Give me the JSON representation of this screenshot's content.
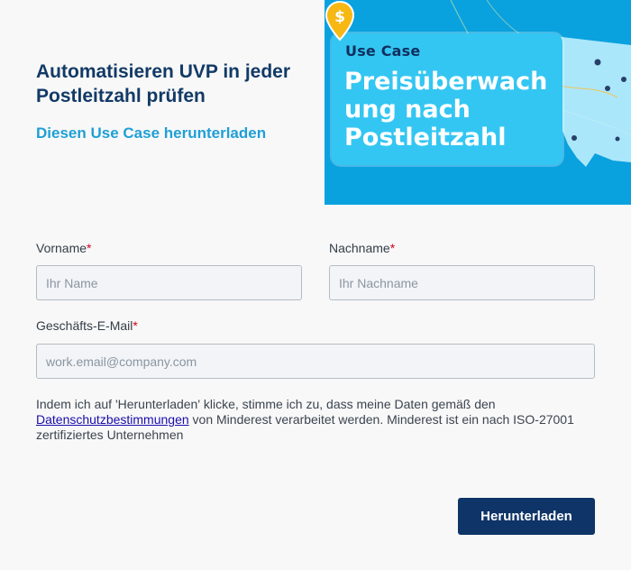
{
  "header": {
    "title": "Automatisieren UVP in jeder Postleitzahl prüfen",
    "download_link": "Diesen Use Case herunterladen"
  },
  "hero": {
    "tag": "Use Case",
    "title": "Preisüberwach\nung nach\nPostleitzahl",
    "icon": "dollar-map-pin",
    "background": "#0aa1df"
  },
  "form": {
    "first_name": {
      "label": "Vorname",
      "required_mark": "*",
      "placeholder": "Ihr Name",
      "value": ""
    },
    "last_name": {
      "label": "Nachname",
      "required_mark": "*",
      "placeholder": "Ihr Nachname",
      "value": ""
    },
    "email": {
      "label": "Geschäfts-E-Mail",
      "required_mark": "*",
      "placeholder": "work.email@company.com",
      "value": ""
    },
    "consent": {
      "before": "Indem ich auf 'Herunterladen' klicke, stimme ich zu, dass meine Daten gemäß den ",
      "link": "Datenschutzbestimmungen",
      "after": " von Minderest verarbeitet werden. Minderest ist ein nach ISO-27001 zertifiziertes Unternehmen"
    },
    "submit_label": "Herunterladen"
  },
  "colors": {
    "primary": "#0f3467",
    "accent": "#1f9fd6",
    "required": "#d0021b"
  }
}
